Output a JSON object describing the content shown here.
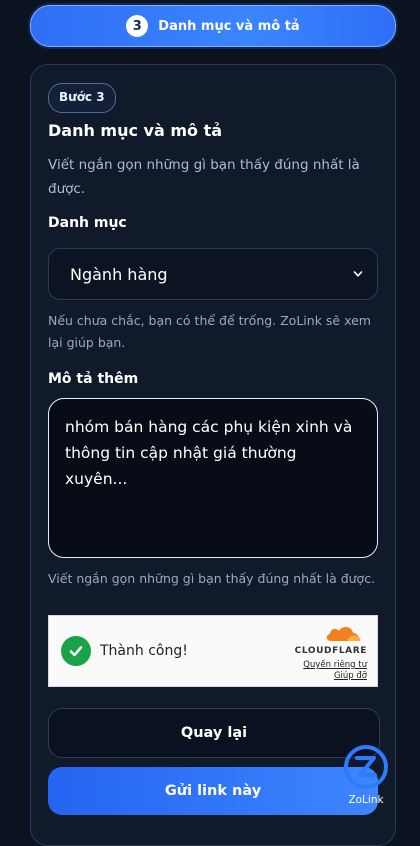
{
  "step_header": {
    "number": "3",
    "title": "Danh mục và mô tả"
  },
  "card": {
    "badge": "Bước 3",
    "title": "Danh mục và mô tả",
    "description": "Viết ngắn gọn những gì bạn thấy đúng nhất là được."
  },
  "category": {
    "label": "Danh mục",
    "selected": "Ngành hàng",
    "hint": "Nếu chưa chắc, bạn có thể để trống. ZoLink sẽ xem lại giúp bạn."
  },
  "description_field": {
    "label": "Mô tả thêm",
    "value": "nhóm bán hàng các phụ kiện xinh và thông tin cập nhật giá thường xuyên...",
    "hint": "Viết ngắn gọn những gì bạn thấy đúng nhất là được."
  },
  "captcha": {
    "status": "Thành công!",
    "provider": "CLOUDFLARE",
    "privacy_link": "Quyền riêng tư",
    "help_link": "Giúp đỡ",
    "success_color": "#1aa346",
    "brand_color": "#f38020"
  },
  "buttons": {
    "back": "Quay lại",
    "submit": "Gửi link này"
  },
  "floating": {
    "label": "ZoLink",
    "icon": "zolink-logo-icon"
  },
  "colors": {
    "accent": "#3a86ff",
    "background": "#0b1220"
  }
}
